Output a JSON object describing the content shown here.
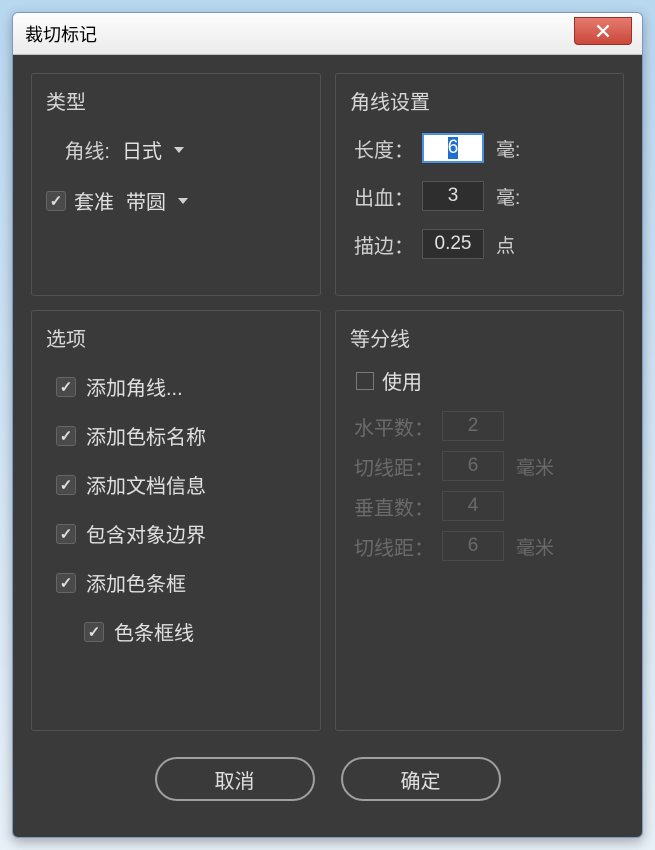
{
  "window": {
    "title": "裁切标记"
  },
  "type": {
    "title": "类型",
    "corner_label": "角线:",
    "corner_value": "日式",
    "registration_checked": true,
    "registration_label": "套准",
    "registration_value": "带圆"
  },
  "corner_settings": {
    "title": "角线设置",
    "length_label": "长度：",
    "length_value": "6",
    "length_unit": "毫:",
    "bleed_label": "出血：",
    "bleed_value": "3",
    "bleed_unit": "毫:",
    "stroke_label": "描边：",
    "stroke_value": "0.25",
    "stroke_unit": "点"
  },
  "options": {
    "title": "选项",
    "items": [
      "添加角线...",
      "添加色标名称",
      "添加文档信息",
      "包含对象边界",
      "添加色条框",
      "色条框线"
    ]
  },
  "division": {
    "title": "等分线",
    "use_label": "使用",
    "use_checked": false,
    "hcount_label": "水平数：",
    "hcount_value": "2",
    "hcut_label": "切线距：",
    "hcut_value": "6",
    "hcut_unit": "毫米",
    "vcount_label": "垂直数：",
    "vcount_value": "4",
    "vcut_label": "切线距：",
    "vcut_value": "6",
    "vcut_unit": "毫米"
  },
  "buttons": {
    "cancel": "取消",
    "ok": "确定"
  }
}
